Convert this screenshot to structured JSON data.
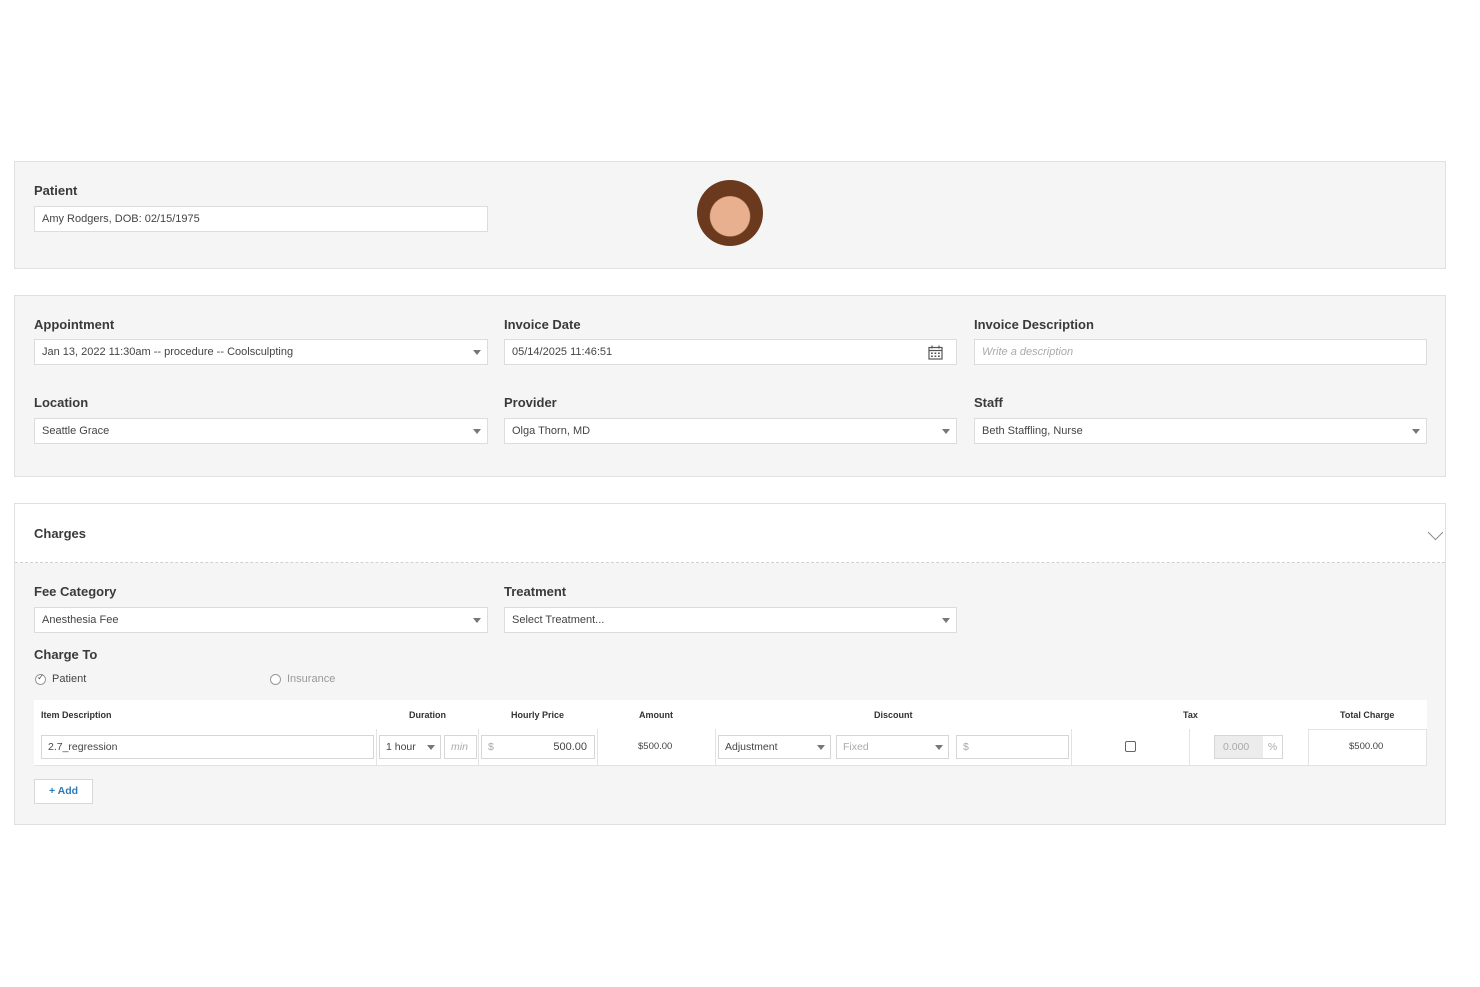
{
  "patient": {
    "label": "Patient",
    "value": "Amy Rodgers, DOB: 02/15/1975"
  },
  "appointment": {
    "label": "Appointment",
    "value": "Jan 13, 2022 11:30am -- procedure -- Coolsculpting"
  },
  "invoice_date": {
    "label": "Invoice Date",
    "value": "05/14/2025 11:46:51"
  },
  "invoice_description": {
    "label": "Invoice Description",
    "placeholder": "Write a description"
  },
  "location": {
    "label": "Location",
    "value": "Seattle Grace"
  },
  "provider": {
    "label": "Provider",
    "value": "Olga Thorn, MD"
  },
  "staff": {
    "label": "Staff",
    "value": "Beth Staffling, Nurse"
  },
  "charges": {
    "title": "Charges",
    "fee_category": {
      "label": "Fee Category",
      "value": "Anesthesia Fee"
    },
    "treatment": {
      "label": "Treatment",
      "value": "Select Treatment..."
    },
    "charge_to": {
      "label": "Charge To",
      "options": [
        "Patient",
        "Insurance"
      ],
      "selected": "Patient"
    },
    "table": {
      "headers": {
        "item_description": "Item Description",
        "duration": "Duration",
        "hourly_price": "Hourly Price",
        "amount": "Amount",
        "discount": "Discount",
        "tax": "Tax",
        "total_charge": "Total Charge"
      },
      "row": {
        "item_description": "2.7_regression",
        "duration_hours": "1 hour",
        "duration_min_placeholder": "min",
        "currency_symbol": "$",
        "hourly_price": "500.00",
        "amount": "$500.00",
        "discount_type": "Adjustment",
        "discount_mode": "Fixed",
        "discount_currency": "$",
        "tax_rate": "0.000",
        "tax_percent_symbol": "%",
        "total_charge": "$500.00"
      }
    },
    "add_button": "+ Add"
  }
}
